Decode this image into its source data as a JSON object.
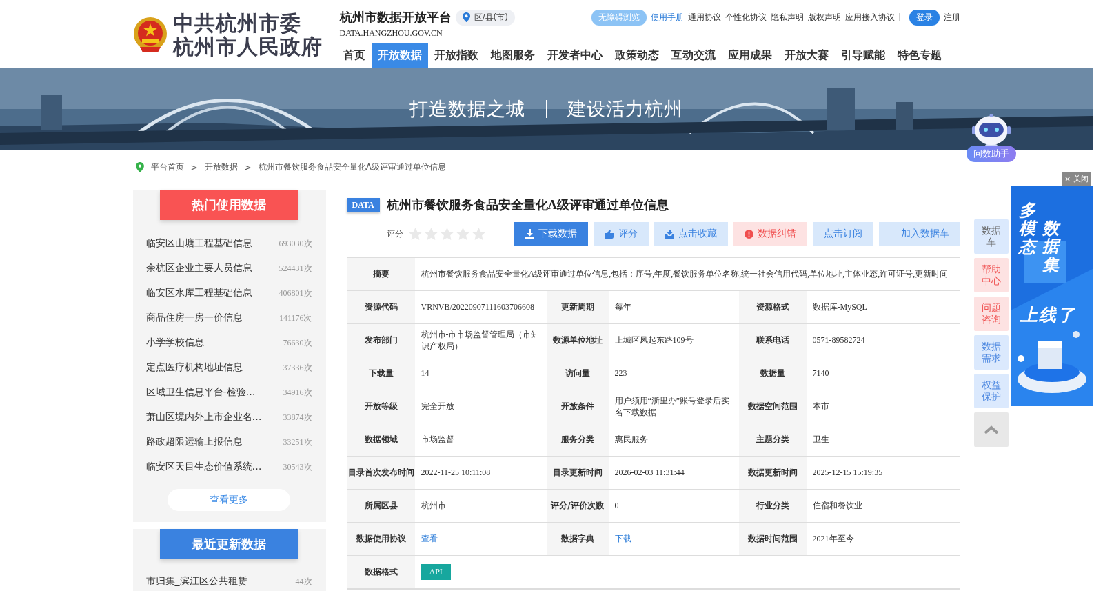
{
  "header": {
    "org_lines": [
      "中共杭州市委",
      "杭州市人民政府"
    ],
    "platform_title": "杭州市数据开放平台",
    "region_selector": "区/县(市)",
    "domain": "DATA.HANGZHOU.GOV.CN",
    "top_links": [
      {
        "label": "无障碍浏览",
        "kind": "pill"
      },
      {
        "label": "使用手册",
        "kind": "link"
      },
      {
        "label": "通用协议",
        "kind": "plain"
      },
      {
        "label": "个性化协议",
        "kind": "plain"
      },
      {
        "label": "隐私声明",
        "kind": "plain"
      },
      {
        "label": "版权声明",
        "kind": "plain"
      },
      {
        "label": "应用接入协议",
        "kind": "plain"
      },
      {
        "label": "登录",
        "kind": "primary"
      },
      {
        "label": "注册",
        "kind": "plain"
      }
    ],
    "nav": [
      {
        "label": "首页",
        "selected": false
      },
      {
        "label": "开放数据",
        "selected": true
      },
      {
        "label": "开放指数",
        "selected": false
      },
      {
        "label": "地图服务",
        "selected": false
      },
      {
        "label": "开发者中心",
        "selected": false
      },
      {
        "label": "政策动态",
        "selected": false
      },
      {
        "label": "互动交流",
        "selected": false
      },
      {
        "label": "应用成果",
        "selected": false
      },
      {
        "label": "开放大赛",
        "selected": false
      },
      {
        "label": "引导赋能",
        "selected": false
      },
      {
        "label": "特色专题",
        "selected": false
      }
    ]
  },
  "banner": {
    "slogan": [
      "打造数据之城",
      "建设活力杭州"
    ]
  },
  "assistant": {
    "label": "问数助手"
  },
  "breadcrumb": {
    "separator": ">",
    "items": [
      "平台首页",
      "开放数据",
      "杭州市餐饮服务食品安全量化A级评审通过单位信息"
    ]
  },
  "hot_data": {
    "title": "热门使用数据",
    "more": "查看更多",
    "items": [
      {
        "name": "临安区山塘工程基础信息",
        "count": "693030次"
      },
      {
        "name": "余杭区企业主要人员信息",
        "count": "524431次"
      },
      {
        "name": "临安区水库工程基础信息",
        "count": "406801次"
      },
      {
        "name": "商品住房一房一价信息",
        "count": "141176次"
      },
      {
        "name": "小学学校信息",
        "count": "76630次"
      },
      {
        "name": "定点医疗机构地址信息",
        "count": "37336次"
      },
      {
        "name": "区域卫生信息平台-检验…",
        "count": "34916次"
      },
      {
        "name": "萧山区境内外上市企业名…",
        "count": "33874次"
      },
      {
        "name": "路政超限运输上报信息",
        "count": "33251次"
      },
      {
        "name": "临安区天目生态价值系统…",
        "count": "30543次"
      }
    ]
  },
  "recent_data": {
    "title": "最近更新数据",
    "items": [
      {
        "name": "市归集_滨江区公共租赁",
        "count": "44次"
      }
    ]
  },
  "dataset": {
    "badge": "DATA",
    "title": "杭州市餐饮服务食品安全量化A级评审通过单位信息",
    "rating": {
      "label": "评分",
      "stars": 0
    },
    "actions": [
      {
        "label": "下载数据",
        "kind": "download"
      },
      {
        "label": "评分",
        "kind": "rate"
      },
      {
        "label": "点击收藏",
        "kind": "favorite"
      },
      {
        "label": "数据纠错",
        "kind": "report"
      },
      {
        "label": "点击订阅",
        "kind": "subscribe"
      },
      {
        "label": "加入数据车",
        "kind": "cart"
      }
    ],
    "summary": {
      "label": "摘要",
      "value": "杭州市餐饮服务食品安全量化A级评审通过单位信息,包括：序号,年度,餐饮服务单位名称,统一社会信用代码,单位地址,主体业态,许可证号,更新时间"
    },
    "rows": [
      [
        {
          "label": "资源代码",
          "value": "VRNVB/20220907111603706608",
          "kind": "text"
        },
        {
          "label": "更新周期",
          "value": "每年",
          "kind": "text"
        },
        {
          "label": "资源格式",
          "value": "数据库-MySQL",
          "kind": "text"
        }
      ],
      [
        {
          "label": "发布部门",
          "value": "杭州市-市市场监督管理局（市知识产权局）",
          "kind": "text"
        },
        {
          "label": "数源单位地址",
          "value": "上城区凤起东路109号",
          "kind": "text"
        },
        {
          "label": "联系电话",
          "value": "0571-89582724",
          "kind": "text"
        }
      ],
      [
        {
          "label": "下载量",
          "value": "14",
          "kind": "text"
        },
        {
          "label": "访问量",
          "value": "223",
          "kind": "text"
        },
        {
          "label": "数据量",
          "value": "7140",
          "kind": "text"
        }
      ],
      [
        {
          "label": "开放等级",
          "value": "完全开放",
          "kind": "text"
        },
        {
          "label": "开放条件",
          "value": "用户须用“浙里办”账号登录后实名下载数据",
          "kind": "text"
        },
        {
          "label": "数据空间范围",
          "value": "本市",
          "kind": "text"
        }
      ],
      [
        {
          "label": "数据领域",
          "value": "市场监督",
          "kind": "text"
        },
        {
          "label": "服务分类",
          "value": "惠民服务",
          "kind": "text"
        },
        {
          "label": "主题分类",
          "value": "卫生",
          "kind": "text"
        }
      ],
      [
        {
          "label": "目录首次发布时间",
          "value": "2022-11-25 10:11:08",
          "kind": "text"
        },
        {
          "label": "目录更新时间",
          "value": "2026-02-03 11:31:44",
          "kind": "text"
        },
        {
          "label": "数据更新时间",
          "value": "2025-12-15 15:19:35",
          "kind": "text"
        }
      ],
      [
        {
          "label": "所属区县",
          "value": "杭州市",
          "kind": "text"
        },
        {
          "label": "评分/评价次数",
          "value": "0",
          "kind": "text"
        },
        {
          "label": "行业分类",
          "value": "住宿和餐饮业",
          "kind": "text"
        }
      ],
      [
        {
          "label": "数据使用协议",
          "value": "查看",
          "kind": "link"
        },
        {
          "label": "数据字典",
          "value": "下载",
          "kind": "link"
        },
        {
          "label": "数据时间范围",
          "value": "2021年至今",
          "kind": "text"
        }
      ],
      [
        {
          "label": "数据格式",
          "value": "API",
          "kind": "tag"
        }
      ]
    ]
  },
  "side_tools": [
    {
      "label": "数据车",
      "kind": "muted"
    },
    {
      "label": "帮助中心",
      "kind": "red"
    },
    {
      "label": "问题咨询",
      "kind": "red"
    },
    {
      "label": "数据需求",
      "kind": "blue"
    },
    {
      "label": "权益保护",
      "kind": "blue"
    }
  ],
  "ad": {
    "close": "× 关闭",
    "columns": [
      "多模态",
      "数据集"
    ],
    "tagline": "上线了"
  }
}
